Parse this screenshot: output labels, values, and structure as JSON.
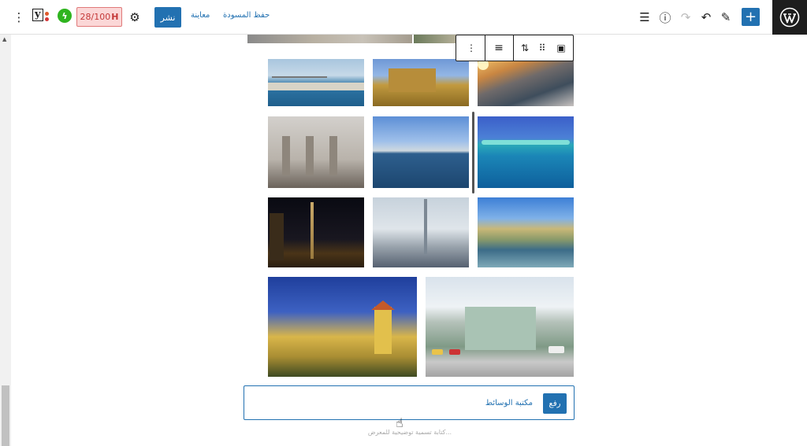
{
  "toolbar": {
    "publish_label": "نشر",
    "preview_label": "معاينة",
    "save_draft_label": "حفظ المسودة",
    "seo_score": "28/100",
    "seo_letter": "H",
    "jetpack_glyph": "ϟ",
    "yoast_glyph": "y",
    "add_glyph": "+",
    "kebab_glyph": "⋮",
    "settings_glyph": "⚙",
    "undo_glyph": "↶",
    "redo_glyph": "↷",
    "info_glyph": "ⓘ",
    "edit_glyph": "✎",
    "list_view_glyph": "☰"
  },
  "block_toolbar": {
    "more_glyph": "⋮",
    "align_glyph": "≡",
    "move_glyph": "⇅",
    "drag_glyph": "⠿",
    "gallery_glyph": "▣"
  },
  "gallery": {
    "images": [
      {
        "name": "harbor-bridge"
      },
      {
        "name": "castle-walls"
      },
      {
        "name": "coastal-town-sunset"
      },
      {
        "name": "palace-colonnade"
      },
      {
        "name": "sea-skyline"
      },
      {
        "name": "turquoise-lagoon"
      },
      {
        "name": "night-tower"
      },
      {
        "name": "city-skyline-tower"
      },
      {
        "name": "lakeside-palace"
      },
      {
        "name": "yellow-building"
      },
      {
        "name": "government-building"
      }
    ]
  },
  "upload": {
    "upload_label": "رفع",
    "media_library_label": "مكتبة الوسائط"
  },
  "caption_placeholder": "كتابة تسمية توضيحية للمعرض...",
  "colors": {
    "accent": "#2271b1",
    "dark": "#1e1e1e",
    "seo_bg": "#fbd7d7",
    "seo_text": "#c43838",
    "jetpack": "#2fb41f"
  }
}
